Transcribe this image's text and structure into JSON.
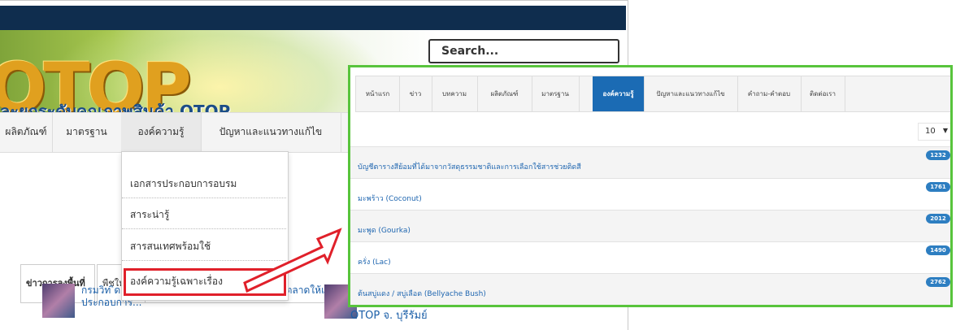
{
  "site": {
    "search_placeholder": "Search...",
    "logo_text": "OTOP",
    "tagline": "ละยกระดับคุณภาพสินค้า OTOP",
    "nav": [
      "ผลิตภัณฑ์",
      "มาตรฐาน",
      "องค์ความรู้",
      "ปัญหาและแนวทางแก้ไข"
    ],
    "dropdown": [
      "เอกสารประกอบการอบรม",
      "สาระน่ารู้",
      "สารสนเทศพร้อมใช้",
      "องค์ความรู้เฉพาะเรื่อง"
    ],
    "content_tabs": [
      "ข่าวการลงพื้นที่",
      "พืชให้สี"
    ],
    "news": [
      {
        "text": "กรมวิท                                     ิด คัดสรรของดีพุรรมย เปดไอกาสทางการตลาดให้แก่ผู้ประกอบการ..."
      },
      {
        "text": "OTOP จ. บุรีรัมย์"
      }
    ]
  },
  "panel": {
    "tabs": [
      "หน้าแรก",
      "ข่าว",
      "บทความ",
      "ผลิตภัณฑ์",
      "มาตรฐาน",
      "องค์ความรู้",
      "ปัญหาและแนวทางแก้ไข",
      "คำถาม-คำตอบ",
      "ติดต่อเรา"
    ],
    "page_size": "10",
    "rows": [
      {
        "title": "บัญชีตารางสีย้อมที่ได้มาจากวัสดุธรรมชาติและการเลือกใช้สารช่วยติดสี",
        "count": "1232"
      },
      {
        "title": "มะพร้าว (Coconut)",
        "count": "1761"
      },
      {
        "title": "มะพูด (Gourka)",
        "count": "2012"
      },
      {
        "title": "ครั่ง (Lac)",
        "count": "1490"
      },
      {
        "title": "ต้นสบู่แดง / สบู่เลือด (Bellyache Bush)",
        "count": "2762"
      }
    ]
  },
  "colors": {
    "highlight": "#e0202a",
    "overlay_border": "#58c43c",
    "active_tab": "#1b6bb4",
    "topbar": "#0f2d4e"
  }
}
